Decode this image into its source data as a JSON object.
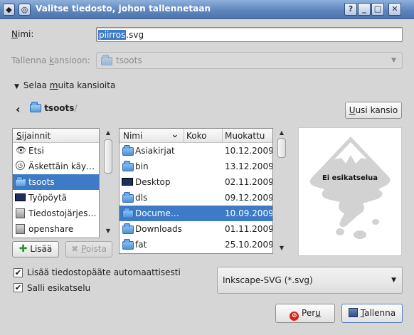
{
  "titlebar": {
    "title": "Valitse tiedosto, johon tallennetaan",
    "icons": [
      "inkscape-icon",
      "menu-icon"
    ],
    "buttons": [
      "help",
      "minimize",
      "maximize",
      "close"
    ],
    "help_glyph": "?",
    "min_glyph": "_",
    "max_glyph": "□",
    "close_glyph": "✕"
  },
  "name_row": {
    "label_prefix": "",
    "label_accel": "N",
    "label_rest": "imi:",
    "value_selected": "piirros",
    "value_rest": ".svg"
  },
  "save_folder": {
    "label_a": "Tallenna ",
    "label_accel": "k",
    "label_b": "ansioon:",
    "value": "tsoots"
  },
  "browse": {
    "label_a": "Selaa ",
    "label_accel": "m",
    "label_b": "uita kansioita"
  },
  "path": {
    "back_glyph": "‹",
    "current": "tsoots",
    "separator": "/",
    "new_folder_accel": "U",
    "new_folder_rest": "usi kansio"
  },
  "places": {
    "header_accel": "S",
    "header_rest": "ijainnit",
    "items": [
      {
        "label": "Etsi",
        "icon": "binoculars-icon"
      },
      {
        "label": "Äskettäin käy…",
        "icon": "recent-clock-icon"
      },
      {
        "label": "tsoots",
        "icon": "home-folder-icon",
        "selected": true
      },
      {
        "label": "Työpöytä",
        "icon": "desktop-icon"
      },
      {
        "label": "Tiedostojärjes…",
        "icon": "filesystem-icon"
      },
      {
        "label": "openshare",
        "icon": "network-share-icon"
      }
    ],
    "add_label": "Lisää",
    "remove_accel": "P",
    "remove_rest": "oista"
  },
  "files": {
    "columns": [
      "Nimi",
      "Koko",
      "Muokattu"
    ],
    "sort_glyph": "⌄",
    "rows": [
      {
        "name": "Asiakirjat",
        "size": "",
        "modified": "10.12.2009",
        "icon": "folder-icon"
      },
      {
        "name": "bin",
        "size": "",
        "modified": "13.12.2009",
        "icon": "folder-icon"
      },
      {
        "name": "Desktop",
        "size": "",
        "modified": "02.11.2009",
        "icon": "desktop-icon"
      },
      {
        "name": "dls",
        "size": "",
        "modified": "09.12.2009",
        "icon": "folder-icon"
      },
      {
        "name": "Docume…",
        "size": "",
        "modified": "10.09.2009",
        "icon": "folder-icon",
        "selected": true
      },
      {
        "name": "Downloads",
        "size": "",
        "modified": "01.11.2009",
        "icon": "folder-icon"
      },
      {
        "name": "fat",
        "size": "",
        "modified": "25.10.2009",
        "icon": "folder-icon"
      }
    ]
  },
  "preview": {
    "text": "Ei esikatselua"
  },
  "options": {
    "auto_ext": "Lisää tiedostopääte automaattisesti",
    "auto_ext_checked": true,
    "enable_preview": "Salli esikatselu",
    "enable_preview_checked": true,
    "check_glyph": "✔"
  },
  "filetype": {
    "value": "Inkscape-SVG (*.svg)"
  },
  "actions": {
    "cancel_a": "Per",
    "cancel_accel": "u",
    "cancel_icon": "cancel-icon",
    "save_accel": "T",
    "save_rest": "allenna",
    "save_icon": "save-icon"
  }
}
